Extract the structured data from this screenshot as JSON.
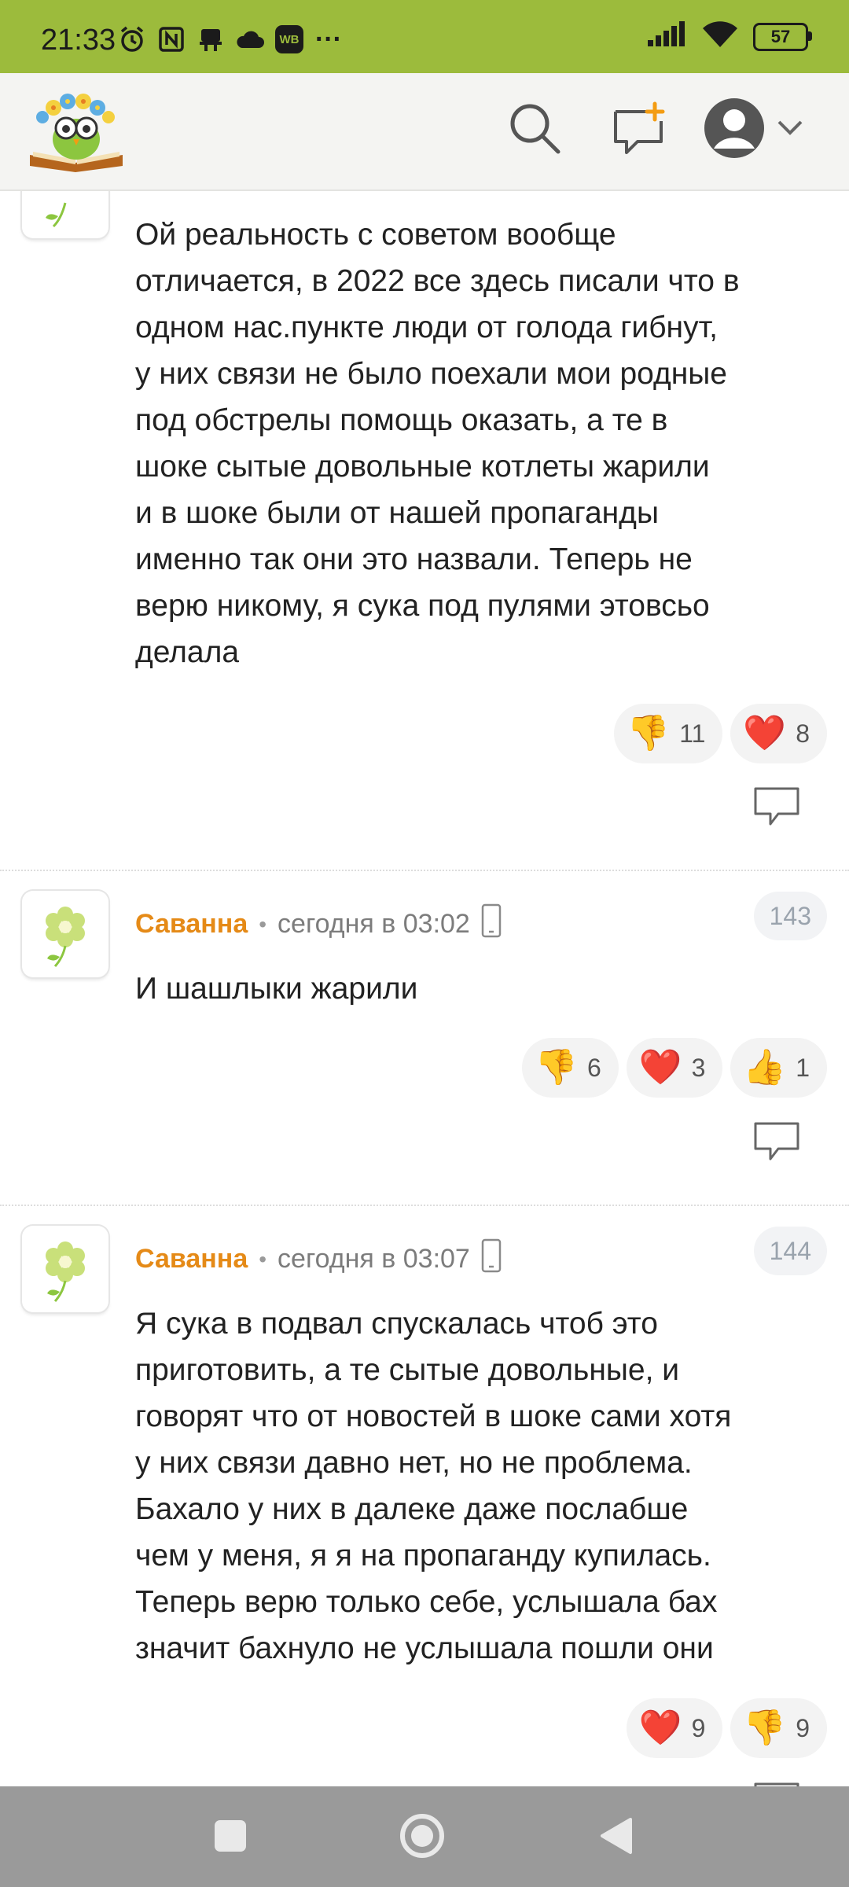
{
  "status_bar": {
    "time": "21:33",
    "left_icons": [
      "alarm-icon",
      "nfc-icon",
      "notification-icon",
      "cloud-icon",
      "wb-app-icon",
      "more-dots-icon"
    ],
    "wb_label": "WB",
    "more": "···",
    "battery": "57"
  },
  "header": {
    "logo": "owl-book-logo",
    "search_icon": "search-icon",
    "new_post_icon": "new-post-icon",
    "avatar_icon": "user-avatar-icon",
    "dropdown_icon": "chevron-down-icon"
  },
  "comments": [
    {
      "text": "Ой реальность с советом вообще\nотличается, в 2022 все здесь писали что в\nодном нас.пункте люди от голода гибнут,\nу них связи не было поехали мои родные\nпод обстрелы помощь оказать, а те в\nшоке сытые довольные котлеты жарили\nи в шоке были от нашей пропаганды\nименно так они это назвали. Теперь не\nверю никому, я сука под пулями этовсьо\nделала",
      "reactions": [
        {
          "emoji": "👎",
          "count": "11"
        },
        {
          "emoji": "❤️",
          "count": "8"
        }
      ]
    },
    {
      "author": "Саванна",
      "separator": "•",
      "time": "сегодня в 03:02",
      "number": "143",
      "text": "И шашлыки жарили",
      "reactions": [
        {
          "emoji": "👎",
          "count": "6"
        },
        {
          "emoji": "❤️",
          "count": "3"
        },
        {
          "emoji": "👍",
          "count": "1"
        }
      ]
    },
    {
      "author": "Саванна",
      "separator": "•",
      "time": "сегодня в 03:07",
      "number": "144",
      "text": "Я сука в подвал спускалась чтоб это\nприготовить, а те сытые довольные, и\nговорят что от новостей в шоке сами хотя\nу них связи давно нет, но не проблема.\nБахало у них в далеке даже послабше\nчем у меня, я я на пропаганду купилась.\nТеперь верю только себе, услышала бах\nзначит бахнуло не услышала пошли они",
      "reactions": [
        {
          "emoji": "❤️",
          "count": "9"
        },
        {
          "emoji": "👎",
          "count": "9"
        }
      ]
    }
  ],
  "nav": {
    "recents": "square-icon",
    "home": "circle-icon",
    "back": "back-triangle-icon"
  }
}
